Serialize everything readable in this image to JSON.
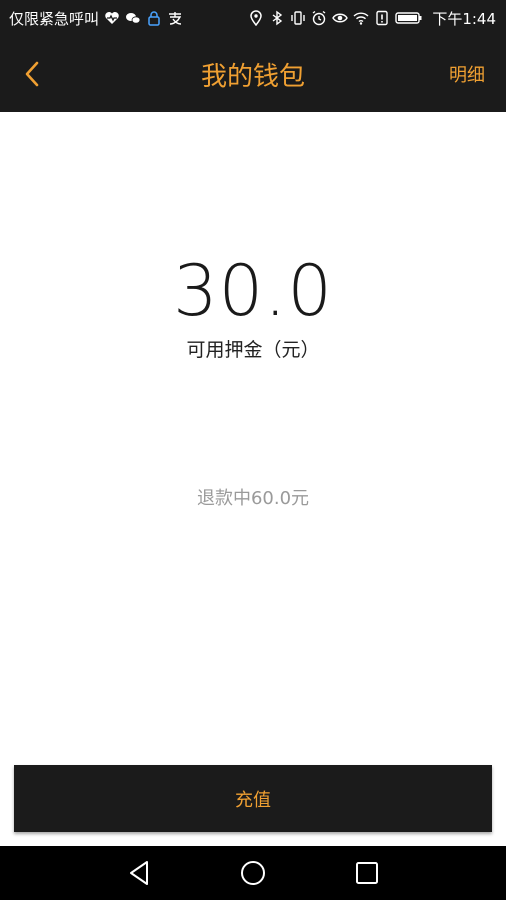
{
  "status_bar": {
    "carrier": "仅限紧急呼叫",
    "left_icons": [
      "heart-pulse-icon",
      "wechat-icon",
      "lock-icon",
      "alipay-icon"
    ],
    "right_icons": [
      "location-icon",
      "bluetooth-icon",
      "vibrate-icon",
      "alarm-icon",
      "eye-icon",
      "wifi-icon",
      "notification-icon",
      "battery-icon"
    ],
    "time": "下午1:44"
  },
  "header": {
    "title": "我的钱包",
    "right_link": "明细",
    "accent_color": "#f0a032"
  },
  "wallet": {
    "amount": "30.0",
    "amount_label": "可用押金（元）",
    "refund_text": "退款中60.0元"
  },
  "actions": {
    "recharge_label": "充值"
  },
  "system_nav": {
    "buttons": [
      "back-icon",
      "home-icon",
      "recents-icon"
    ]
  }
}
